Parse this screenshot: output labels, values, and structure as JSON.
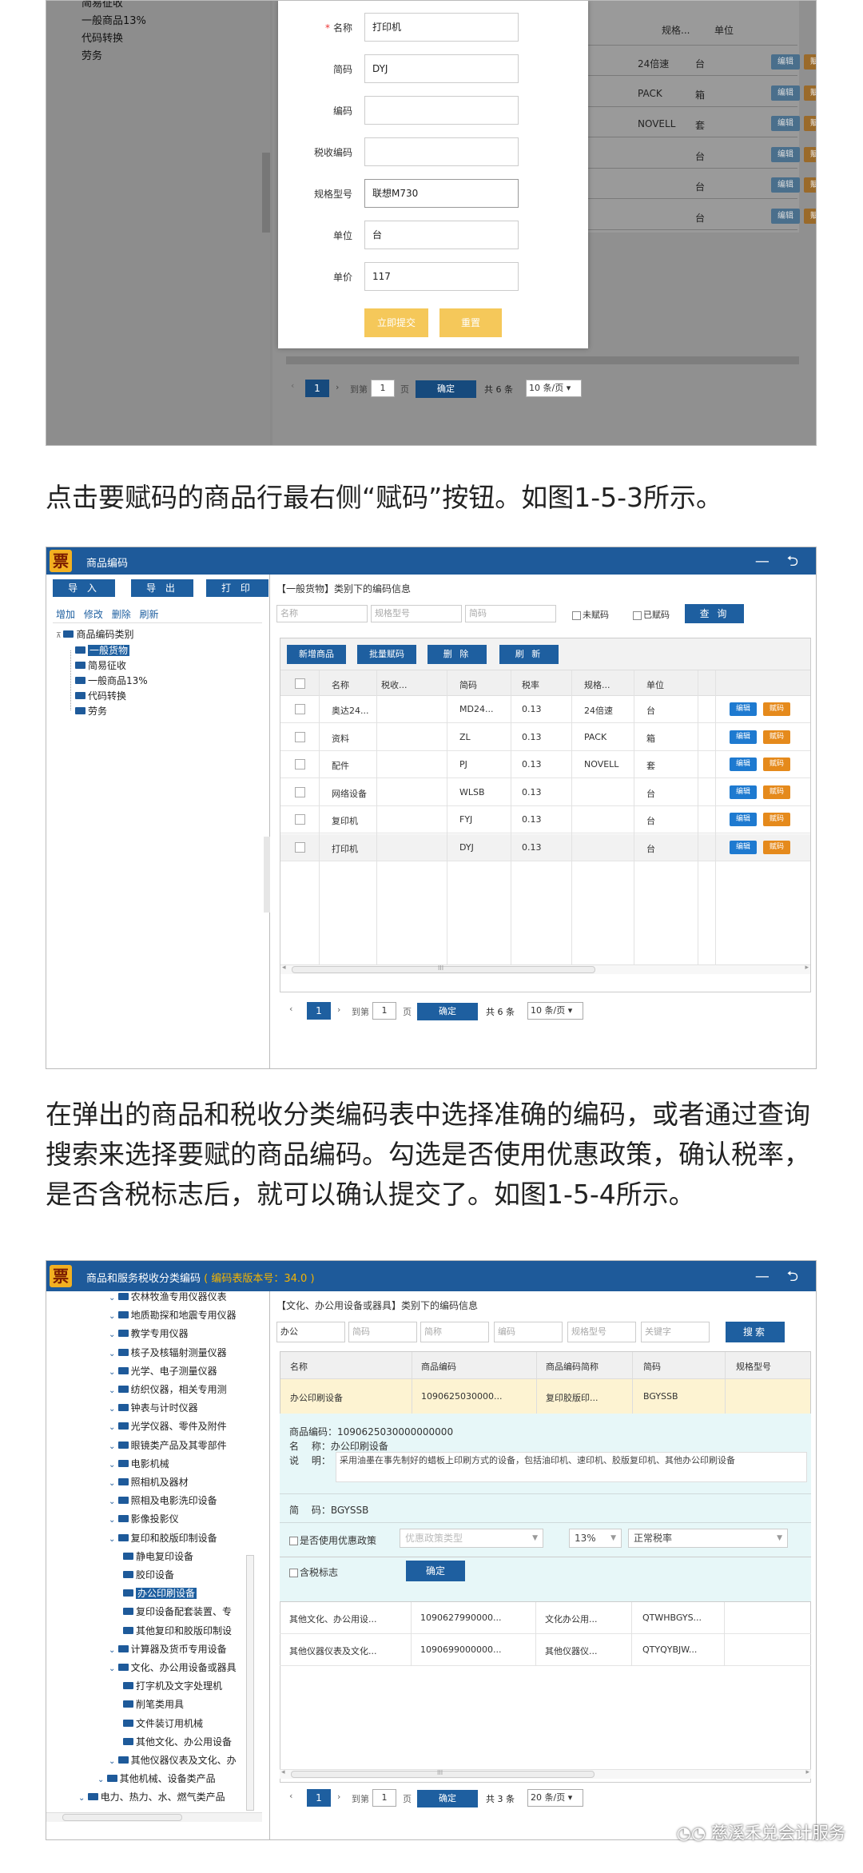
{
  "s1": {
    "tree": [
      "简易征收",
      "一般商品13%",
      "代码转换",
      "劳务"
    ],
    "grid_head": [
      "规格...",
      "单位"
    ],
    "grid_rows": [
      {
        "spec": "24倍速",
        "unit": "台"
      },
      {
        "spec": "PACK",
        "unit": "箱"
      },
      {
        "spec": "NOVELL",
        "unit": "套"
      },
      {
        "spec": "",
        "unit": "台"
      },
      {
        "spec": "",
        "unit": "台"
      },
      {
        "spec": "",
        "unit": "台"
      }
    ],
    "edit_label": "编辑",
    "assign_label": "赋码",
    "modal": {
      "fields": [
        {
          "label": "名称",
          "value": "打印机",
          "required": true
        },
        {
          "label": "简码",
          "value": "DYJ"
        },
        {
          "label": "编码",
          "value": ""
        },
        {
          "label": "税收编码",
          "value": ""
        },
        {
          "label": "规格型号",
          "value": "联想M730"
        },
        {
          "label": "单位",
          "value": "台"
        },
        {
          "label": "单价",
          "value": "117"
        }
      ],
      "required_mark": "*",
      "submit": "立即提交",
      "reset": "重置"
    },
    "pager": {
      "page": "1",
      "goto": "到第",
      "page_input": "1",
      "page_unit": "页",
      "ok": "确定",
      "total": "共 6 条",
      "per_page": "10 条/页"
    }
  },
  "text1": "点击要赋码的商品行最右侧“赋码”按钮。如图1-5-3所示。",
  "s2": {
    "title": "商品编码",
    "logo": "票",
    "win_controls": "— ⮌",
    "toolbar": [
      "导 入",
      "导 出",
      "打 印"
    ],
    "links": [
      "增加",
      "修改",
      "删除",
      "刷新"
    ],
    "tree": {
      "root": "商品编码类别",
      "items": [
        "一般货物",
        "简易征收",
        "一般商品13%",
        "代码转换",
        "劳务"
      ]
    },
    "crumb": "【一般货物】类别下的编码信息",
    "filters": [
      "名称",
      "规格型号",
      "简码"
    ],
    "uncoded": "未赋码",
    "coded": "已赋码",
    "query": "查 询",
    "actions": [
      "新增商品",
      "批量赋码",
      "删 除",
      "刷 新"
    ],
    "columns": [
      "名称",
      "税收...",
      "简码",
      "税率",
      "规格...",
      "单位"
    ],
    "rows": [
      {
        "name": "奥达24...",
        "code": "MD24...",
        "rate": "0.13",
        "spec": "24倍速",
        "unit": "台"
      },
      {
        "name": "资料",
        "code": "ZL",
        "rate": "0.13",
        "spec": "PACK",
        "unit": "箱"
      },
      {
        "name": "配件",
        "code": "PJ",
        "rate": "0.13",
        "spec": "NOVELL",
        "unit": "套"
      },
      {
        "name": "网络设备",
        "code": "WLSB",
        "rate": "0.13",
        "spec": "",
        "unit": "台"
      },
      {
        "name": "复印机",
        "code": "FYJ",
        "rate": "0.13",
        "spec": "",
        "unit": "台"
      },
      {
        "name": "打印机",
        "code": "DYJ",
        "rate": "0.13",
        "spec": "",
        "unit": "台"
      }
    ],
    "edit_label": "编辑",
    "assign_label": "赋码",
    "scroll_mark": "III",
    "pager": {
      "page": "1",
      "goto": "到第",
      "page_input": "1",
      "page_unit": "页",
      "ok": "确定",
      "total": "共 6 条",
      "per_page": "10 条/页"
    }
  },
  "text2": "在弹出的商品和税收分类编码表中选择准确的编码，或者通过查询搜索来选择要赋的商品编码。勾选是否使用优惠政策，确认税率，是否含税标志后，就可以确认提交了。如图1-5-4所示。",
  "s3": {
    "title": "商品和服务税收分类编码",
    "version": "( 编码表版本号：34.0 )",
    "logo": "票",
    "win_controls": "— ⮌",
    "tree": [
      {
        "t": "农林牧渔专用仪器仪表",
        "lvl": 1
      },
      {
        "t": "地质勘探和地震专用仪器",
        "lvl": 1
      },
      {
        "t": "教学专用仪器",
        "lvl": 1
      },
      {
        "t": "核子及核辐射测量仪器",
        "lvl": 1
      },
      {
        "t": "光学、电子测量仪器",
        "lvl": 1
      },
      {
        "t": "纺织仪器，相关专用测",
        "lvl": 1
      },
      {
        "t": "钟表与计时仪器",
        "lvl": 1
      },
      {
        "t": "光学仪器、零件及附件",
        "lvl": 1
      },
      {
        "t": "眼镜类产品及其零部件",
        "lvl": 1
      },
      {
        "t": "电影机械",
        "lvl": 1
      },
      {
        "t": "照相机及器材",
        "lvl": 1
      },
      {
        "t": "照相及电影洗印设备",
        "lvl": 1
      },
      {
        "t": "影像投影仪",
        "lvl": 1
      },
      {
        "t": "复印和胶版印制设备",
        "lvl": 1
      },
      {
        "t": "静电复印设备",
        "lvl": 2
      },
      {
        "t": "胶印设备",
        "lvl": 2
      },
      {
        "t": "办公印刷设备",
        "lvl": 2,
        "sel": true
      },
      {
        "t": "复印设备配套装置、专",
        "lvl": 2
      },
      {
        "t": "其他复印和胶版印制设",
        "lvl": 2
      },
      {
        "t": "计算器及货币专用设备",
        "lvl": 1
      },
      {
        "t": "文化、办公用设备或器具",
        "lvl": 1
      },
      {
        "t": "打字机及文字处理机",
        "lvl": 2
      },
      {
        "t": "削笔类用具",
        "lvl": 2
      },
      {
        "t": "文件装订用机械",
        "lvl": 2
      },
      {
        "t": "其他文化、办公用设备",
        "lvl": 2
      },
      {
        "t": "其他仪器仪表及文化、办",
        "lvl": 1
      },
      {
        "t": "其他机械、设备类产品",
        "lvl": 0
      },
      {
        "t": "电力、热力、水、燃气类产品",
        "lvl": -1
      }
    ],
    "crumb": "【文化、办公用设备或器具】类别下的编码信息",
    "search_value": "办公",
    "filters": [
      "简码",
      "简称",
      "编码",
      "规格型号",
      "关键字"
    ],
    "search": "搜索",
    "columns": [
      "名称",
      "商品编码",
      "商品编码简称",
      "简码",
      "规格型号"
    ],
    "selected_row": {
      "name": "办公印刷设备",
      "code": "1090625030000...",
      "short": "复印胶版印...",
      "abbr": "BGYSSB"
    },
    "detail": {
      "code_label": "商品编码：",
      "code": "1090625030000000000",
      "name_label": "名　 称：",
      "name": "办公印刷设备",
      "desc_label": "说　 明：",
      "desc": "采用油墨在事先制好的蜡板上印刷方式的设备，包括油印机、速印机、胶版复印机、其他办公印刷设备",
      "abbr_label": "简　 码：",
      "abbr": "BGYSSB",
      "preferential": "是否使用优惠政策",
      "preferential_type": "优惠政策类型",
      "rate": "13%",
      "rate_type": "正常税率",
      "tax_included": "含税标志",
      "confirm": "确定"
    },
    "rows": [
      {
        "name": "其他文化、办公用设...",
        "code": "1090627990000...",
        "short": "文化办公用...",
        "abbr": "QTWHBGYS..."
      },
      {
        "name": "其他仪器仪表及文化...",
        "code": "1090699000000...",
        "short": "其他仪器仪...",
        "abbr": "QTYQYBJW..."
      }
    ],
    "scroll_mark": "III",
    "pager": {
      "page": "1",
      "goto": "到第",
      "page_input": "1",
      "page_unit": "页",
      "ok": "确定",
      "total": "共 3 条",
      "per_page": "20 条/页"
    }
  },
  "watermark": "慈溪禾兑会计服务",
  "watermark_icon": "wechat-icon"
}
